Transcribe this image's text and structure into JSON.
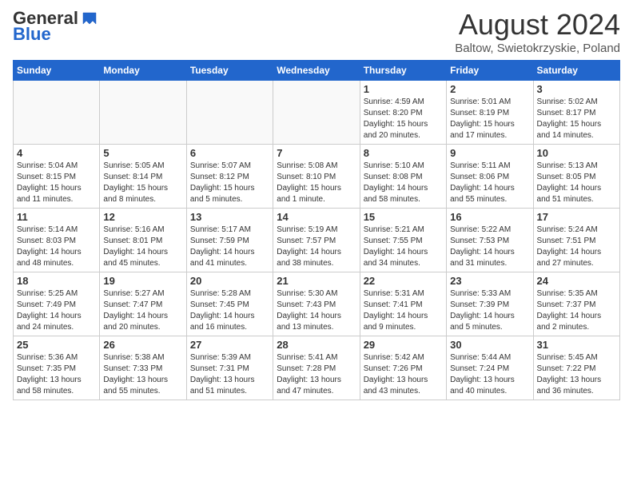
{
  "header": {
    "logo_general": "General",
    "logo_blue": "Blue",
    "month_year": "August 2024",
    "location": "Baltow, Swietokrzyskie, Poland"
  },
  "days_of_week": [
    "Sunday",
    "Monday",
    "Tuesday",
    "Wednesday",
    "Thursday",
    "Friday",
    "Saturday"
  ],
  "weeks": [
    [
      {
        "day": "",
        "info": ""
      },
      {
        "day": "",
        "info": ""
      },
      {
        "day": "",
        "info": ""
      },
      {
        "day": "",
        "info": ""
      },
      {
        "day": "1",
        "info": "Sunrise: 4:59 AM\nSunset: 8:20 PM\nDaylight: 15 hours\nand 20 minutes."
      },
      {
        "day": "2",
        "info": "Sunrise: 5:01 AM\nSunset: 8:19 PM\nDaylight: 15 hours\nand 17 minutes."
      },
      {
        "day": "3",
        "info": "Sunrise: 5:02 AM\nSunset: 8:17 PM\nDaylight: 15 hours\nand 14 minutes."
      }
    ],
    [
      {
        "day": "4",
        "info": "Sunrise: 5:04 AM\nSunset: 8:15 PM\nDaylight: 15 hours\nand 11 minutes."
      },
      {
        "day": "5",
        "info": "Sunrise: 5:05 AM\nSunset: 8:14 PM\nDaylight: 15 hours\nand 8 minutes."
      },
      {
        "day": "6",
        "info": "Sunrise: 5:07 AM\nSunset: 8:12 PM\nDaylight: 15 hours\nand 5 minutes."
      },
      {
        "day": "7",
        "info": "Sunrise: 5:08 AM\nSunset: 8:10 PM\nDaylight: 15 hours\nand 1 minute."
      },
      {
        "day": "8",
        "info": "Sunrise: 5:10 AM\nSunset: 8:08 PM\nDaylight: 14 hours\nand 58 minutes."
      },
      {
        "day": "9",
        "info": "Sunrise: 5:11 AM\nSunset: 8:06 PM\nDaylight: 14 hours\nand 55 minutes."
      },
      {
        "day": "10",
        "info": "Sunrise: 5:13 AM\nSunset: 8:05 PM\nDaylight: 14 hours\nand 51 minutes."
      }
    ],
    [
      {
        "day": "11",
        "info": "Sunrise: 5:14 AM\nSunset: 8:03 PM\nDaylight: 14 hours\nand 48 minutes."
      },
      {
        "day": "12",
        "info": "Sunrise: 5:16 AM\nSunset: 8:01 PM\nDaylight: 14 hours\nand 45 minutes."
      },
      {
        "day": "13",
        "info": "Sunrise: 5:17 AM\nSunset: 7:59 PM\nDaylight: 14 hours\nand 41 minutes."
      },
      {
        "day": "14",
        "info": "Sunrise: 5:19 AM\nSunset: 7:57 PM\nDaylight: 14 hours\nand 38 minutes."
      },
      {
        "day": "15",
        "info": "Sunrise: 5:21 AM\nSunset: 7:55 PM\nDaylight: 14 hours\nand 34 minutes."
      },
      {
        "day": "16",
        "info": "Sunrise: 5:22 AM\nSunset: 7:53 PM\nDaylight: 14 hours\nand 31 minutes."
      },
      {
        "day": "17",
        "info": "Sunrise: 5:24 AM\nSunset: 7:51 PM\nDaylight: 14 hours\nand 27 minutes."
      }
    ],
    [
      {
        "day": "18",
        "info": "Sunrise: 5:25 AM\nSunset: 7:49 PM\nDaylight: 14 hours\nand 24 minutes."
      },
      {
        "day": "19",
        "info": "Sunrise: 5:27 AM\nSunset: 7:47 PM\nDaylight: 14 hours\nand 20 minutes."
      },
      {
        "day": "20",
        "info": "Sunrise: 5:28 AM\nSunset: 7:45 PM\nDaylight: 14 hours\nand 16 minutes."
      },
      {
        "day": "21",
        "info": "Sunrise: 5:30 AM\nSunset: 7:43 PM\nDaylight: 14 hours\nand 13 minutes."
      },
      {
        "day": "22",
        "info": "Sunrise: 5:31 AM\nSunset: 7:41 PM\nDaylight: 14 hours\nand 9 minutes."
      },
      {
        "day": "23",
        "info": "Sunrise: 5:33 AM\nSunset: 7:39 PM\nDaylight: 14 hours\nand 5 minutes."
      },
      {
        "day": "24",
        "info": "Sunrise: 5:35 AM\nSunset: 7:37 PM\nDaylight: 14 hours\nand 2 minutes."
      }
    ],
    [
      {
        "day": "25",
        "info": "Sunrise: 5:36 AM\nSunset: 7:35 PM\nDaylight: 13 hours\nand 58 minutes."
      },
      {
        "day": "26",
        "info": "Sunrise: 5:38 AM\nSunset: 7:33 PM\nDaylight: 13 hours\nand 55 minutes."
      },
      {
        "day": "27",
        "info": "Sunrise: 5:39 AM\nSunset: 7:31 PM\nDaylight: 13 hours\nand 51 minutes."
      },
      {
        "day": "28",
        "info": "Sunrise: 5:41 AM\nSunset: 7:28 PM\nDaylight: 13 hours\nand 47 minutes."
      },
      {
        "day": "29",
        "info": "Sunrise: 5:42 AM\nSunset: 7:26 PM\nDaylight: 13 hours\nand 43 minutes."
      },
      {
        "day": "30",
        "info": "Sunrise: 5:44 AM\nSunset: 7:24 PM\nDaylight: 13 hours\nand 40 minutes."
      },
      {
        "day": "31",
        "info": "Sunrise: 5:45 AM\nSunset: 7:22 PM\nDaylight: 13 hours\nand 36 minutes."
      }
    ]
  ]
}
